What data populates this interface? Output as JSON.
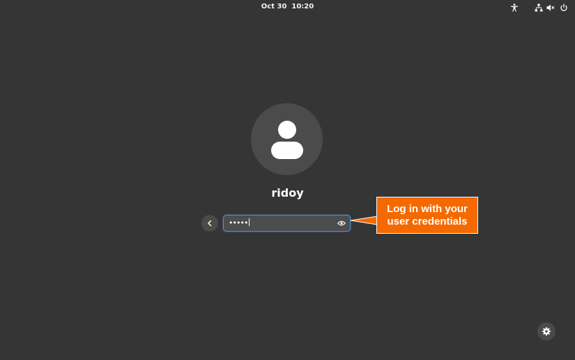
{
  "topbar": {
    "clock": "Oct 30  10:20",
    "icons": [
      "accessibility-icon",
      "network-icon",
      "volume-muted-icon",
      "power-icon"
    ]
  },
  "login": {
    "avatar_icon": "user-icon",
    "username": "ridoy",
    "password_mask": "•••••",
    "back_icon": "chevron-left-icon",
    "reveal_icon": "eye-icon",
    "focus_color": "#4f8ad8"
  },
  "callout": {
    "line1": "Log in with your",
    "line2": "user credentials",
    "color": "#f56a00"
  },
  "footer": {
    "settings_icon": "gear-icon"
  },
  "colors": {
    "background": "#353535",
    "avatar_bg": "#4b4b4b"
  }
}
